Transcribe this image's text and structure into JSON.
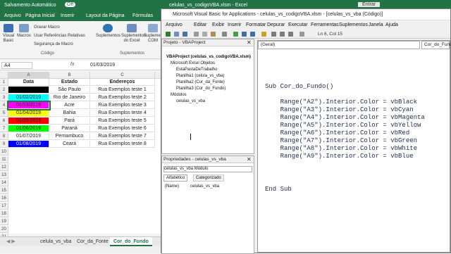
{
  "excel": {
    "autosave": "Salvamento Automático",
    "autosave_state": "Off",
    "title": "celulas_vs_codigoVBA.xlsm - Excel",
    "signin": "Entrar",
    "tabs": [
      "Arquivo",
      "Página Inicial",
      "Inserir",
      "Layout da Página",
      "Fórmulas"
    ],
    "ribbon": {
      "visual_basic": "Visual Basic",
      "macros": "Macros",
      "record": "Gravar Macro",
      "relative": "Usar Referências Relativas",
      "security": "Segurança de Macro",
      "group_code": "Código",
      "addins": "Suplementos",
      "excel_addins": "Suplementos do Excel",
      "com_addins": "Suplementos COM",
      "group_addins": "Suplementos"
    },
    "namebox": "A4",
    "fx": "fx",
    "formula_value": "01/03/2019",
    "columns": [
      "A",
      "B",
      "C"
    ],
    "headers": {
      "data": "Data",
      "estado": "Estado",
      "enderecos": "Endereços"
    },
    "rows": [
      {
        "num": "1",
        "data": "Data",
        "estado": "Estado",
        "end": "Endereços",
        "color": "#ffffff"
      },
      {
        "num": "2",
        "data": "",
        "estado": "São Paulo",
        "end": "Rua Exemplos teste 1",
        "color": "#000000"
      },
      {
        "num": "3",
        "data": "01/02/2019",
        "estado": "Rio de Janeiro",
        "end": "Rua Exemplos teste 2",
        "color": "#00ffff"
      },
      {
        "num": "4",
        "data": "01/03/2019",
        "estado": "Acre",
        "end": "Rua Exemplos teste 3",
        "color": "#ff00ff"
      },
      {
        "num": "5",
        "data": "01/04/2019",
        "estado": "Bahia",
        "end": "Rua Exemplos teste 4",
        "color": "#ffff00"
      },
      {
        "num": "6",
        "data": "01/05/2019",
        "estado": "Pará",
        "end": "Rua Exemplos teste 5",
        "color": "#ff0000"
      },
      {
        "num": "7",
        "data": "01/06/2019",
        "estado": "Paraná",
        "end": "Rua Exemplos teste 6",
        "color": "#00ff00"
      },
      {
        "num": "8",
        "data": "01/07/2019",
        "estado": "Pernambuco",
        "end": "Rua Exemplos teste 7",
        "color": "#ffffff"
      },
      {
        "num": "9",
        "data": "01/08/2019",
        "estado": "Ceará",
        "end": "Rua Exemplos teste 8",
        "color": "#0000ff"
      }
    ],
    "empty_rows": [
      "10",
      "11",
      "12",
      "13",
      "14",
      "15",
      "16",
      "17",
      "18",
      "19",
      "20",
      "21"
    ],
    "sheets": [
      "celula_vs_vba",
      "Cor_da_Fonte",
      "Cor_do_Fundo"
    ],
    "active_sheet": "Cor_do_Fundo"
  },
  "vba": {
    "title": "Microsoft Visual Basic for Applications - celulas_vs_codigoVBA.xlsm - [celulas_vs_vba (Código)]",
    "menu": [
      "Arquivo",
      "Editar",
      "Exibir",
      "Inserir",
      "Formatar",
      "Depurar",
      "Executar",
      "Ferramentas",
      "Suplementos",
      "Janela",
      "Ajuda"
    ],
    "position": "Ln 6, Col 15",
    "project": {
      "header": "Projeto - VBAProject",
      "root": "VBAProject (celulas_vs_codigoVBA.xlsm)",
      "folder": "Microsoft Excel Objetos",
      "items": [
        "EstaPastaDeTrabalho",
        "Planilha1 (celula_vs_vba)",
        "Planilha2 (Cor_da_Fonte)",
        "Planilha3 (Cor_do_Fundo)"
      ],
      "modules": "Módulos",
      "module_item": "celulas_vs_vba"
    },
    "props": {
      "header": "Propriedades - celulas_vs_vba",
      "object": "celulas_vs_vba",
      "object_type": "Módulo",
      "tab_alpha": "Alfabético",
      "tab_cat": "Categorizado",
      "name_key": "(Name)",
      "name_val": "celulas_vs_vba"
    },
    "combo_left": "(Geral)",
    "combo_right": "Cor_do_Fundo",
    "code": [
      "Sub Cor_do_Fundo()",
      "",
      "    Range(\"A2\").Interior.Color = vbBlack",
      "    Range(\"A3\").Interior.Color = vbCyan",
      "    Range(\"A4\").Interior.Color = vbMagenta",
      "    Range(\"A5\").Interior.Color = vbYellow",
      "    Range(\"A6\").Interior.Color = vbRed",
      "    Range(\"A7\").Interior.Color = vbGreen",
      "    Range(\"A8\").Interior.Color = vbWhite",
      "    Range(\"A9\").Interior.Color = vbBlue"
    ],
    "end_sub": "End Sub"
  }
}
